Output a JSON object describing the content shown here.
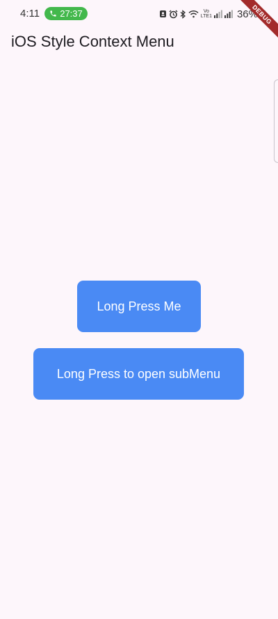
{
  "status_bar": {
    "time": "4:11",
    "call_timer": "27:37",
    "battery_percent": "36%",
    "volte_label": "Vo",
    "lte_label": "LTE1",
    "icons": [
      "phone-icon",
      "notification-icon",
      "alarm-icon",
      "bluetooth-icon",
      "wifi-icon",
      "signal-icon",
      "signal-icon-2",
      "battery-icon"
    ],
    "call_pill_color": "#43b84c"
  },
  "debug_banner": {
    "label": "DEBUG",
    "color": "#a32b2b"
  },
  "app_bar": {
    "title": "iOS Style Context Menu"
  },
  "main": {
    "buttons": [
      {
        "label": "Long Press Me"
      },
      {
        "label": "Long Press to open subMenu"
      }
    ],
    "button_color": "#4a8af4",
    "background_color": "#fdf6fb"
  }
}
